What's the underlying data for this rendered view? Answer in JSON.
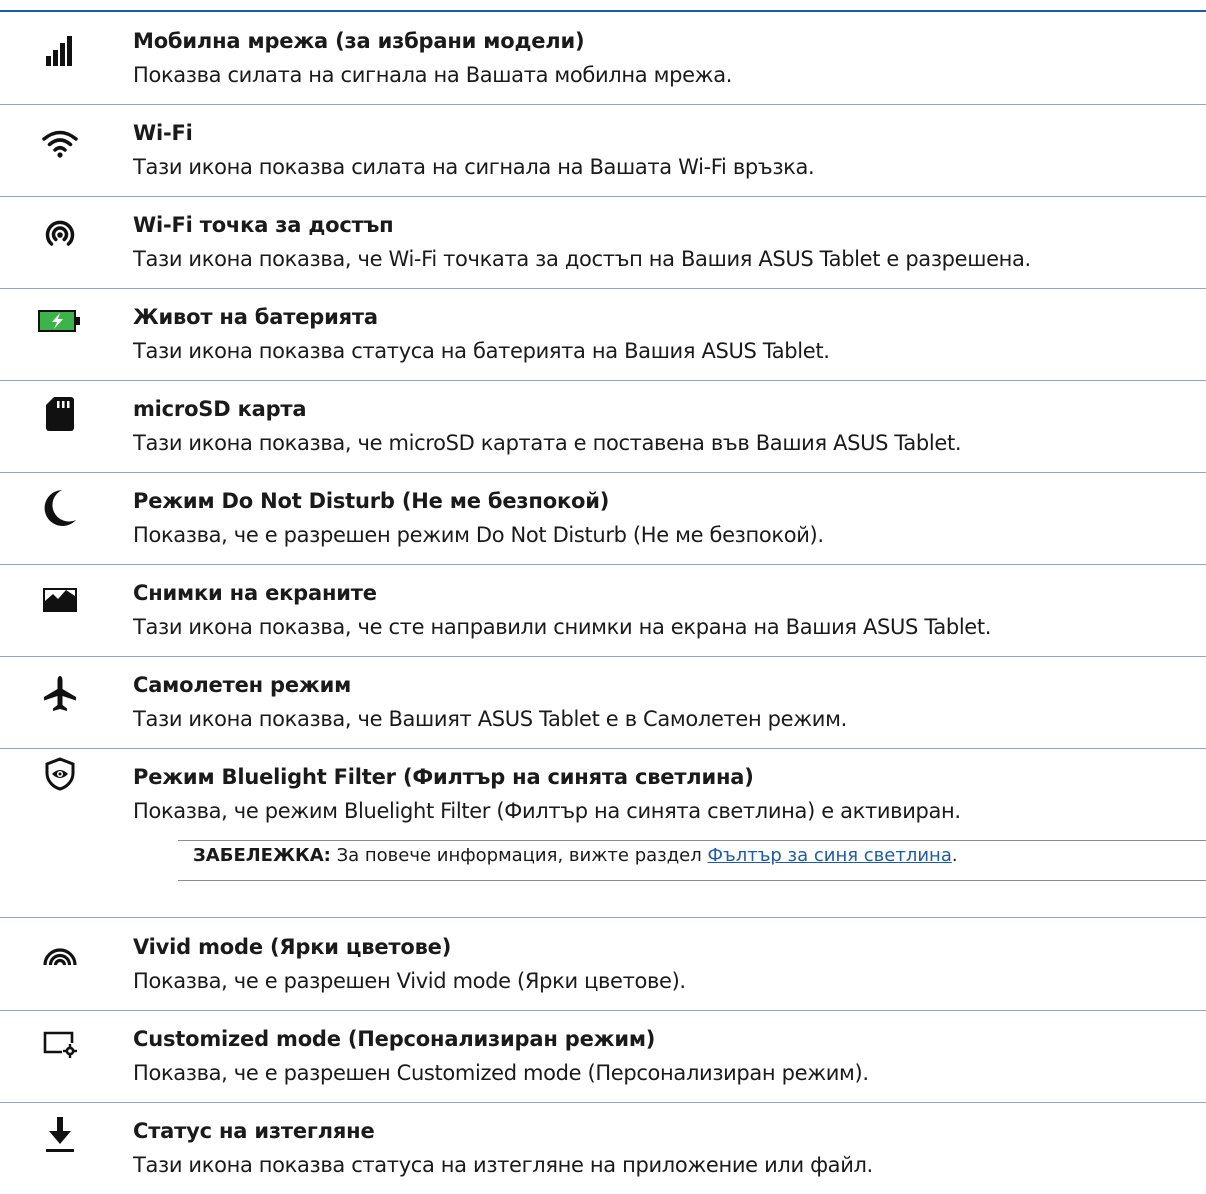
{
  "items": [
    {
      "icon": "signal-bars-icon",
      "title": "Мобилна мрежа (за избрани модели)",
      "desc": "Показва силата на сигнала на Вашата мобилна мрежа."
    },
    {
      "icon": "wifi-icon",
      "title": "Wi-Fi",
      "desc": "Тази икона показва силата на сигнала на Вашата Wi-Fi връзка."
    },
    {
      "icon": "hotspot-icon",
      "title": "Wi-Fi точка за достъп",
      "desc": "Тази икона показва, че Wi-Fi точката за достъп на Вашия ASUS Tablet е разрешена."
    },
    {
      "icon": "battery-charging-icon",
      "title": "Живот на батерията",
      "desc": "Тази икона показва статуса на батерията на Вашия ASUS Tablet."
    },
    {
      "icon": "microsd-card-icon",
      "title": "microSD карта",
      "desc": "Тази икона показва, че microSD картата е поставена във Вашия ASUS Tablet."
    },
    {
      "icon": "moon-icon",
      "title": "Режим Do Not Disturb (Не ме безпокой)",
      "desc": "Показва, че е разрешен режим Do Not Disturb (Не ме безпокой)."
    },
    {
      "icon": "screenshot-image-icon",
      "title": "Снимки на екраните",
      "desc": "Тази икона показва, че сте направили снимки на екрана на Вашия ASUS Tablet."
    },
    {
      "icon": "airplane-icon",
      "title": "Самолетен режим",
      "desc": "Тази икона показва, че Вашият ASUS Tablet е в Самолетен режим."
    },
    {
      "icon": "bluelight-filter-icon",
      "title": "Режим Bluelight Filter (Филтър на синята светлина)",
      "desc": "Показва, че режим Bluelight Filter (Филтър на синята светлина) е активиран."
    },
    {
      "icon": "vivid-mode-icon",
      "title": "Vivid mode (Ярки цветове)",
      "desc": "Показва, че е разрешен Vivid mode (Ярки цветове)."
    },
    {
      "icon": "customized-mode-icon",
      "title": "Customized mode (Персонализиран режим)",
      "desc": "Показва, че е разрешен Customized mode (Персонализиран режим)."
    },
    {
      "icon": "download-icon",
      "title": "Статус на изтегляне",
      "desc": "Тази икона показва статуса на изтегляне на приложение или файл."
    }
  ],
  "note": {
    "label": "ЗАБЕЛЕЖКА:",
    "text": " За повече информация, вижте раздел ",
    "link": "Фълтър за синя светлина",
    "end": "."
  },
  "colors": {
    "accent": "#1f5aa6",
    "battery_green": "#3cb44a"
  }
}
